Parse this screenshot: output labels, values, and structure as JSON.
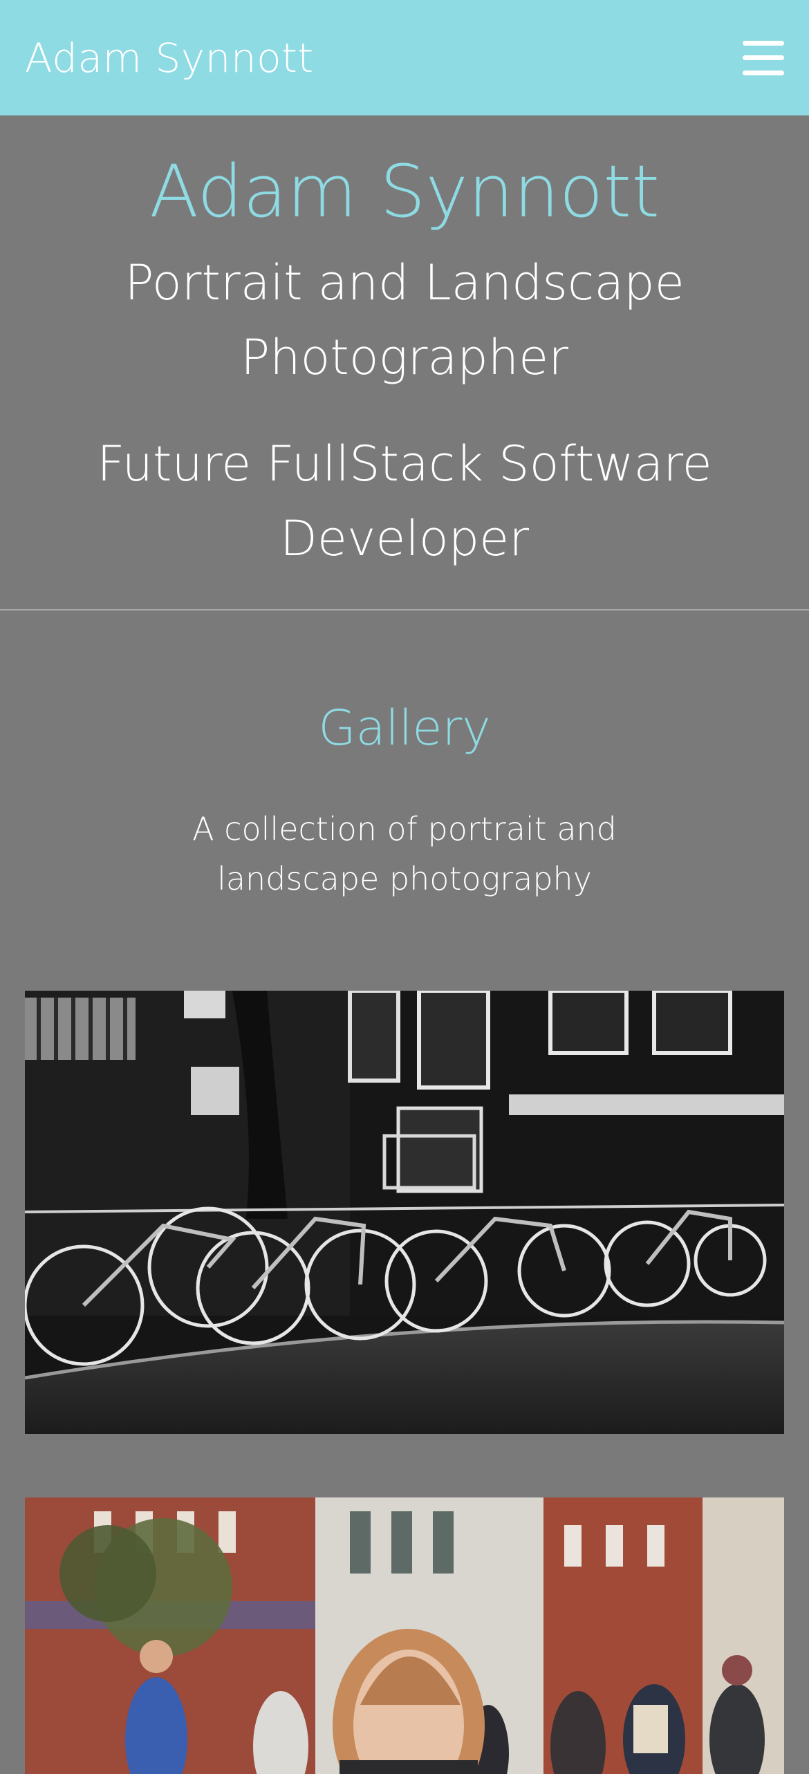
{
  "navbar": {
    "brand": "Adam Synnott",
    "menu_icon": "hamburger-menu-icon"
  },
  "hero": {
    "title": "Adam Synnott",
    "subtitle": "Portrait and Landscape Photographer",
    "subtitle_2": "Future FullStack Software Developer"
  },
  "gallery": {
    "title": "Gallery",
    "description": "A collection of portrait and landscape photography",
    "photos": [
      {
        "subject": "bicycles-black-and-white-photo"
      },
      {
        "subject": "woman-in-busy-street-photo"
      }
    ]
  },
  "colors": {
    "accent": "#8fdbe3",
    "background": "#7a7a7a",
    "text": "#ffffff"
  }
}
